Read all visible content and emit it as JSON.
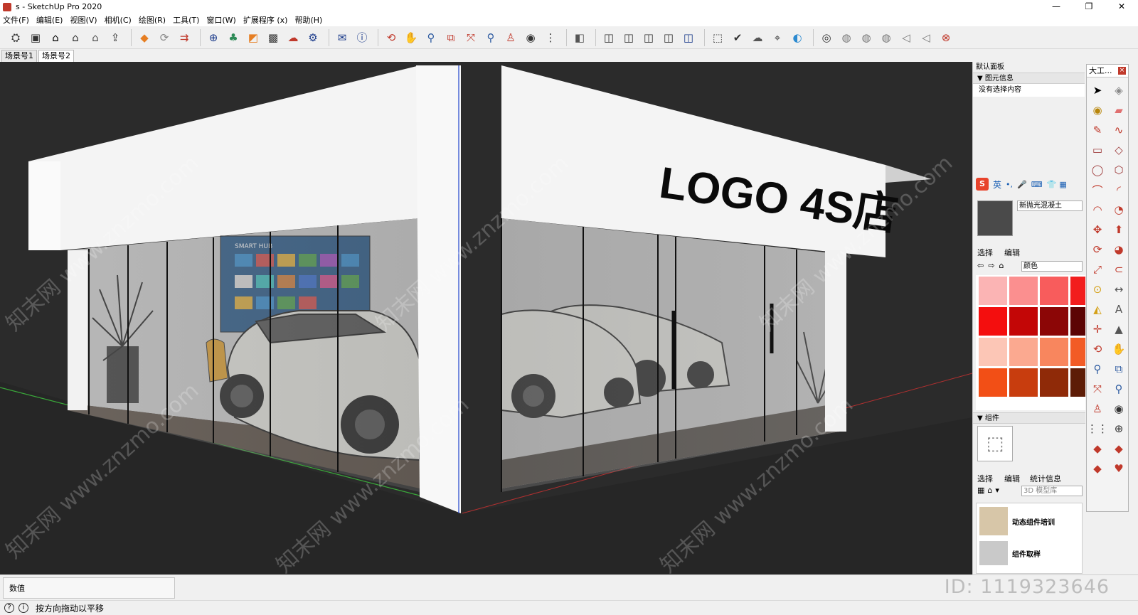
{
  "window": {
    "title": "s - SketchUp Pro 2020",
    "min_glyph": "—",
    "max_glyph": "❐",
    "close_glyph": "✕"
  },
  "menu": [
    "文件(F)",
    "编辑(E)",
    "视图(V)",
    "相机(C)",
    "绘图(R)",
    "工具(T)",
    "窗口(W)",
    "扩展程序 (x)",
    "帮助(H)"
  ],
  "toolbar_icons": [
    "get-models-icon",
    "component-icon",
    "home-icon",
    "warehouse-icon",
    "3d-home-icon",
    "share-icon",
    "sep",
    "extension-icon",
    "refresh-icon",
    "export-icon",
    "sep",
    "add-icon",
    "tree-icon",
    "layers-icon",
    "checker-icon",
    "cloud-up-icon",
    "settings-icon",
    "sep",
    "mail-icon",
    "info-icon",
    "sep",
    "orbit-icon",
    "pan-icon",
    "zoom-icon",
    "zoom-window-icon",
    "zoom-extents-icon",
    "zoom-previous-icon",
    "position-camera-icon",
    "look-around-icon",
    "walk-icon",
    "sep",
    "section-plane-icon",
    "sep",
    "iso-view-icon",
    "top-view-icon",
    "front-view-icon",
    "right-view-icon",
    "back-view-icon",
    "sep",
    "cube-icon",
    "send-icon",
    "cloud-share-icon",
    "add-location-icon",
    "colorize-icon",
    "sep",
    "camera-icon",
    "scene-a-icon",
    "scene-b-icon",
    "scene-c-icon",
    "scene-d-icon",
    "scene-e-icon",
    "close-scene-icon"
  ],
  "scene_tabs": [
    {
      "label": "场景号1",
      "active": false
    },
    {
      "label": "场景号2",
      "active": true
    }
  ],
  "viewport": {
    "logo_text": "LOGO 4S店",
    "watermark": "知末网 www.znzmo.com",
    "screen_title": "SMART HUB"
  },
  "tray": {
    "title": "默认面板",
    "entity_info": {
      "header": "▼ 图元信息",
      "text": "没有选择内容"
    },
    "ime_label": "英",
    "material_name": "新抛光混凝土",
    "material_tabs": [
      "选择",
      "编辑"
    ],
    "material_category": "颜色",
    "swatch_colors": [
      "#fbb4b4",
      "#fb8f8f",
      "#f85c5c",
      "#f21d1d",
      "#f40e0e",
      "#c30606",
      "#8c0606",
      "#5c0404",
      "#fcc6b6",
      "#fba990",
      "#f8865e",
      "#f25b26",
      "#f24f16",
      "#c83d0e",
      "#8f2a08",
      "#5d1c06"
    ],
    "components": {
      "header": "▼ 组件",
      "tabs": [
        "选择",
        "编辑",
        "统计信息"
      ],
      "search_placeholder": "3D 模型库",
      "items": [
        "动态组件培训",
        "组件取样"
      ]
    }
  },
  "tool_palette": {
    "title": "大工...",
    "close_glyph": "×",
    "tools": [
      {
        "name": "select-icon",
        "glyph": "➤",
        "color": "#000"
      },
      {
        "name": "eraser-alt-icon",
        "glyph": "◈",
        "color": "#888"
      },
      {
        "name": "paint-bucket-icon",
        "glyph": "◉",
        "color": "#b8860b"
      },
      {
        "name": "eraser-icon",
        "glyph": "▰",
        "color": "#e07070"
      },
      {
        "name": "pencil-icon",
        "glyph": "✎",
        "color": "#c0392b"
      },
      {
        "name": "freehand-icon",
        "glyph": "∿",
        "color": "#c0392b"
      },
      {
        "name": "rectangle-icon",
        "glyph": "▭",
        "color": "#a04040"
      },
      {
        "name": "rotated-rect-icon",
        "glyph": "◇",
        "color": "#a04040"
      },
      {
        "name": "circle-icon",
        "glyph": "◯",
        "color": "#a04040"
      },
      {
        "name": "polygon-icon",
        "glyph": "⬡",
        "color": "#a04040"
      },
      {
        "name": "arc-icon",
        "glyph": "⌒",
        "color": "#c0392b"
      },
      {
        "name": "arc-2-icon",
        "glyph": "◜",
        "color": "#c0392b"
      },
      {
        "name": "arc-3-icon",
        "glyph": "◠",
        "color": "#c0392b"
      },
      {
        "name": "pie-icon",
        "glyph": "◔",
        "color": "#c0392b"
      },
      {
        "name": "move-icon",
        "glyph": "✥",
        "color": "#c0392b"
      },
      {
        "name": "push-pull-icon",
        "glyph": "⬆",
        "color": "#c0392b"
      },
      {
        "name": "rotate-icon",
        "glyph": "⟳",
        "color": "#c0392b"
      },
      {
        "name": "follow-me-icon",
        "glyph": "◕",
        "color": "#c0392b"
      },
      {
        "name": "scale-icon",
        "glyph": "⤢",
        "color": "#c0392b"
      },
      {
        "name": "offset-icon",
        "glyph": "⊂",
        "color": "#c0392b"
      },
      {
        "name": "tape-measure-icon",
        "glyph": "⊙",
        "color": "#d4a017"
      },
      {
        "name": "dimension-icon",
        "glyph": "↔",
        "color": "#555"
      },
      {
        "name": "protractor-icon",
        "glyph": "◭",
        "color": "#d4a017"
      },
      {
        "name": "text-icon",
        "glyph": "A",
        "color": "#555"
      },
      {
        "name": "axes-icon",
        "glyph": "✛",
        "color": "#c0392b"
      },
      {
        "name": "3d-text-icon",
        "glyph": "▲",
        "color": "#555"
      },
      {
        "name": "orbit-icon",
        "glyph": "⟲",
        "color": "#c0392b"
      },
      {
        "name": "pan-icon",
        "glyph": "✋",
        "color": "#d4a017"
      },
      {
        "name": "zoom-icon",
        "glyph": "⚲",
        "color": "#2c5aa0"
      },
      {
        "name": "zoom-window-icon",
        "glyph": "⧉",
        "color": "#2c5aa0"
      },
      {
        "name": "zoom-extents-icon",
        "glyph": "⤧",
        "color": "#c0392b"
      },
      {
        "name": "previous-icon",
        "glyph": "⚲",
        "color": "#2c5aa0"
      },
      {
        "name": "position-camera-icon",
        "glyph": "♙",
        "color": "#c0392b"
      },
      {
        "name": "look-around-icon",
        "glyph": "◉",
        "color": "#333"
      },
      {
        "name": "walk-icon",
        "glyph": "⋮⋮",
        "color": "#333"
      },
      {
        "name": "section-plane-icon",
        "glyph": "⊕",
        "color": "#333"
      },
      {
        "name": "solid-union-icon",
        "glyph": "◆",
        "color": "#c0392b"
      },
      {
        "name": "solid-subtract-icon",
        "glyph": "◆",
        "color": "#c0392b"
      },
      {
        "name": "solid-trim-icon",
        "glyph": "◆",
        "color": "#c0392b"
      },
      {
        "name": "solid-split-icon",
        "glyph": "♥",
        "color": "#c0392b"
      }
    ]
  },
  "status": {
    "vcb_label": "数值",
    "message": "按方向拖动以平移",
    "id_stamp": "ID: 1119323646"
  }
}
